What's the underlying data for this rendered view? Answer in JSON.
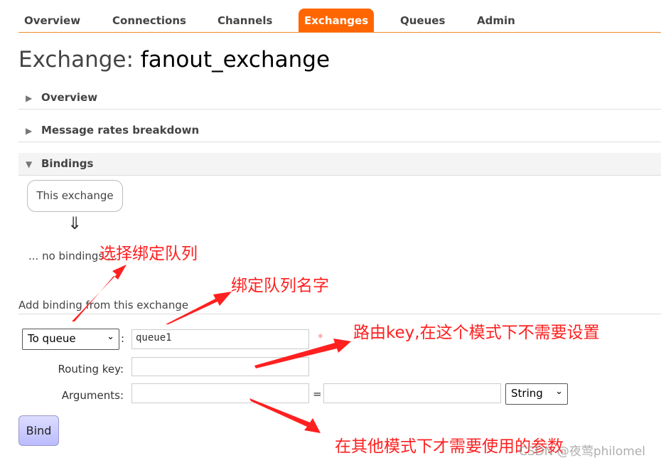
{
  "nav": {
    "tabs": [
      {
        "label": "Overview"
      },
      {
        "label": "Connections"
      },
      {
        "label": "Channels"
      },
      {
        "label": "Exchanges",
        "active": true
      },
      {
        "label": "Queues"
      },
      {
        "label": "Admin"
      }
    ],
    "accent": "#ff6600"
  },
  "header": {
    "prefix": "Exchange:",
    "name": "fanout_exchange"
  },
  "sections": [
    {
      "label": "Overview",
      "expanded": false
    },
    {
      "label": "Message rates breakdown",
      "expanded": false
    },
    {
      "label": "Bindings",
      "expanded": true
    }
  ],
  "bindings": {
    "source": "This exchange",
    "arrow": "⇓",
    "empty": "... no bindings ..."
  },
  "add_binding": {
    "title": "Add binding from this exchange",
    "destination_type": "To queue",
    "destination_value": "queue1",
    "required_mark": "*",
    "routing_key_label": "Routing key:",
    "routing_key_value": "",
    "arguments_label": "Arguments:",
    "arg_key": "",
    "equals": "=",
    "arg_value": "",
    "arg_type": "String",
    "bind_label": "Bind",
    "colon": ":"
  },
  "annotations": [
    "选择绑定队列",
    "绑定队列名字",
    "路由key,在这个模式下不需要设置",
    "在其他模式下才需要使用的参数"
  ],
  "annotation_color": "#ff2020",
  "watermark": "CSDN @夜莺philomel"
}
